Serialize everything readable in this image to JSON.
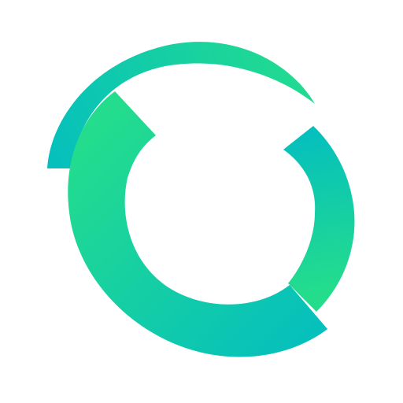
{
  "logo": {
    "icon": "circular-arrows-logo-icon",
    "colors": {
      "background": "#ffffff",
      "green": "#24DD8C",
      "teal": "#05BFBE"
    }
  }
}
